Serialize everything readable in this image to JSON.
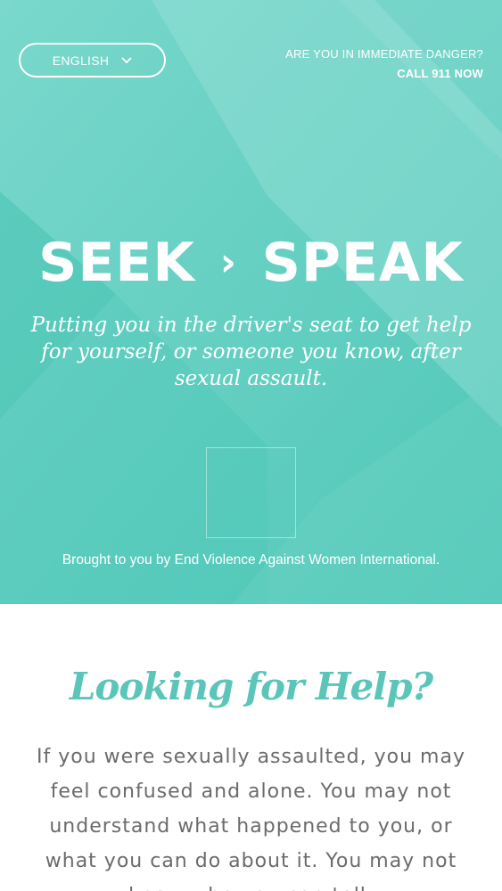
{
  "header": {
    "language_label": "ENGLISH",
    "danger_question": "ARE YOU IN IMMEDIATE DANGER?",
    "danger_call": "CALL 911 NOW"
  },
  "hero": {
    "logo_left": "SEEK",
    "logo_separator": "›",
    "logo_right": "SPEAK",
    "tagline": "Putting you in the driver's seat to get help for yourself, or someone you know, after sexual assault.",
    "credit": "Brought to you by End Violence Against Women International."
  },
  "help": {
    "title": "Looking for Help?",
    "body": "If you were sexually assaulted, you may feel confused and alone. You may not understand what happened to you, or what you can do about it. You may not know who you can tell."
  },
  "colors": {
    "hero_teal": "#58cec0",
    "heading_teal": "#5cc5b9",
    "body_gray": "#6b6b6b"
  },
  "icons": {
    "language_dropdown": "chevron-down-icon"
  }
}
